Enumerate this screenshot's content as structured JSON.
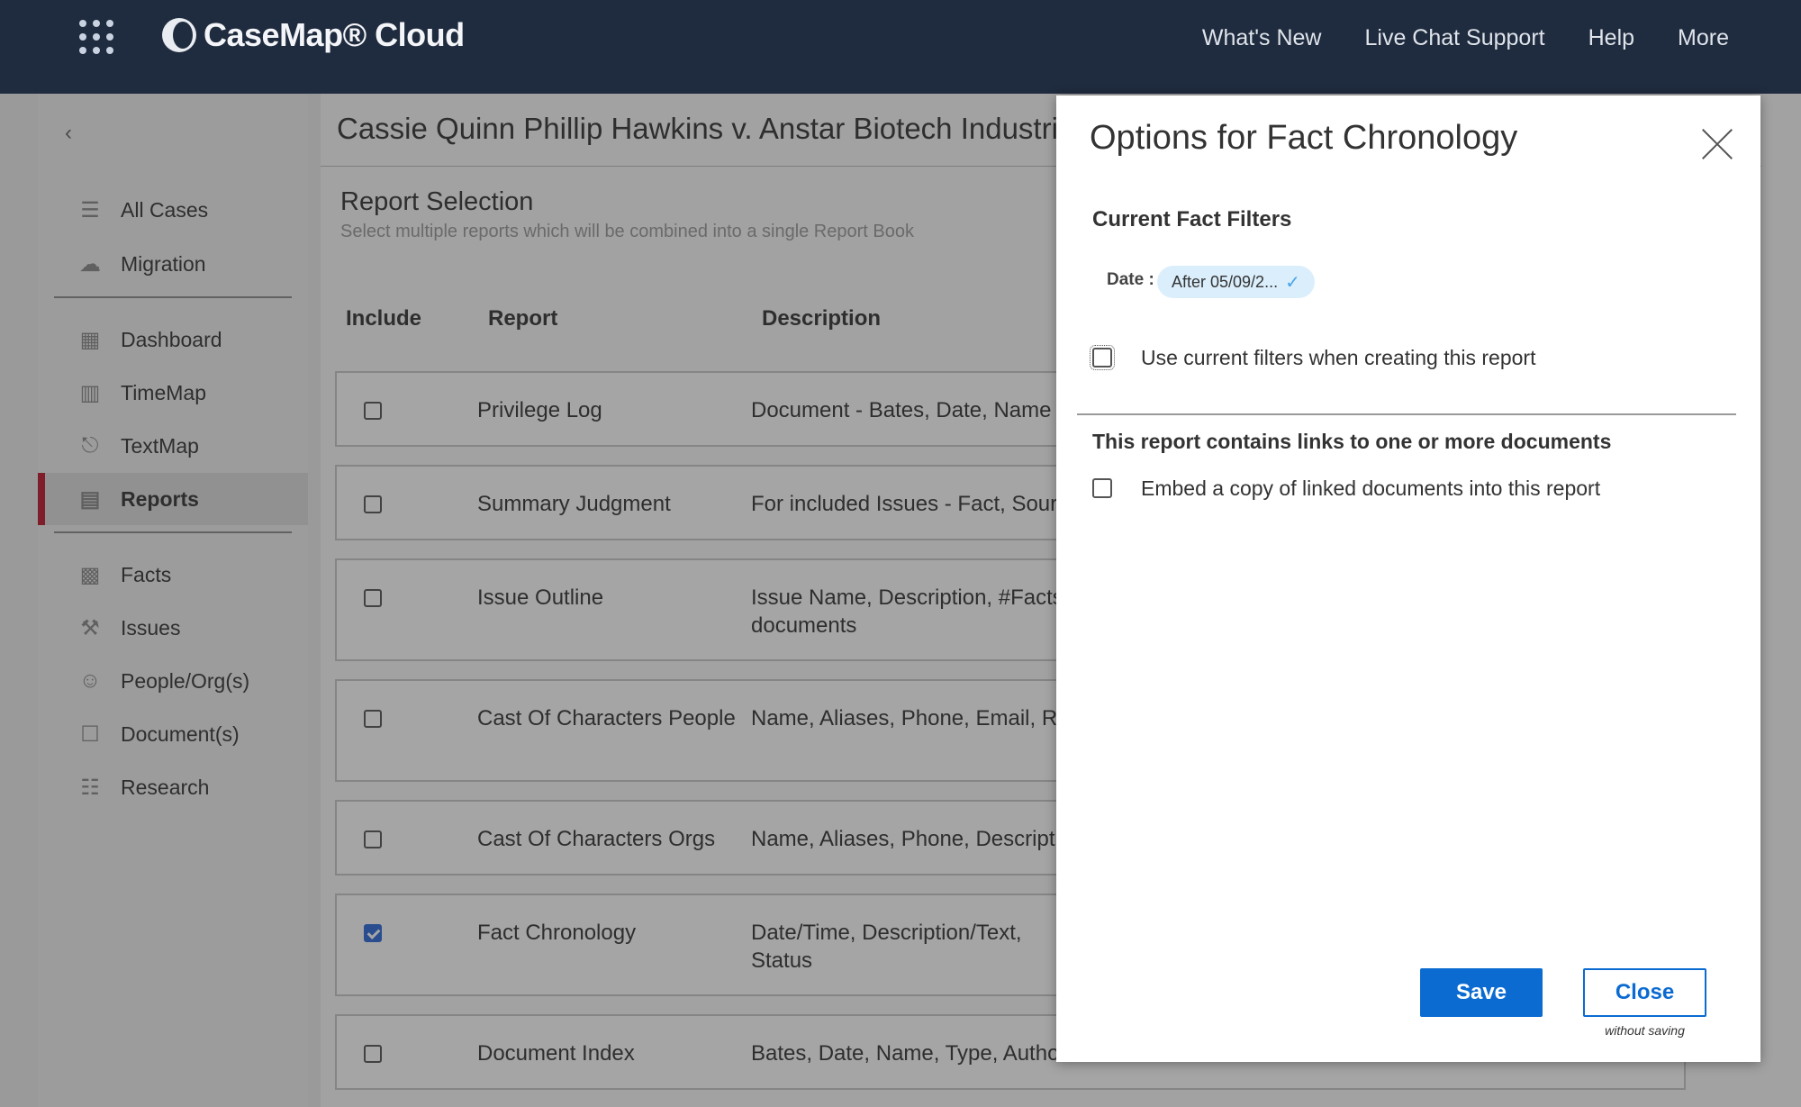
{
  "topbar": {
    "logo_text": "CaseMap® Cloud",
    "nav": [
      "What's New",
      "Live Chat Support",
      "Help",
      "More"
    ]
  },
  "sidebar": {
    "items": [
      {
        "label": "All Cases",
        "icon": "list-icon"
      },
      {
        "label": "Migration",
        "icon": "cloud-upload-icon"
      },
      {
        "label": "Dashboard",
        "icon": "dashboard-icon"
      },
      {
        "label": "TimeMap",
        "icon": "timemap-icon"
      },
      {
        "label": "TextMap",
        "icon": "microphone-icon"
      },
      {
        "label": "Reports",
        "icon": "reports-icon",
        "active": true
      },
      {
        "label": "Facts",
        "icon": "facts-icon"
      },
      {
        "label": "Issues",
        "icon": "gavel-icon"
      },
      {
        "label": "People/Org(s)",
        "icon": "people-icon"
      },
      {
        "label": "Document(s)",
        "icon": "document-icon"
      },
      {
        "label": "Research",
        "icon": "library-icon"
      }
    ]
  },
  "main": {
    "case_title": "Cassie Quinn Phillip Hawkins v. Anstar Biotech Industries",
    "section_title": "Report Selection",
    "section_subtitle": "Select multiple reports which will be combined into a single Report Book",
    "columns": [
      "Include",
      "Report",
      "Description"
    ],
    "rows": [
      {
        "name": "Privilege Log",
        "description": "Document - Bates, Date, Name",
        "checked": false
      },
      {
        "name": "Summary Judgment",
        "description": "For included Issues - Fact, Source",
        "checked": false
      },
      {
        "name": "Issue Outline",
        "description": "Issue Name, Description, #Facts\ndocuments",
        "checked": false
      },
      {
        "name": "Cast Of Characters People",
        "description": "Name, Aliases, Phone, Email, Role",
        "checked": false
      },
      {
        "name": "Cast Of Characters Orgs",
        "description": "Name, Aliases, Phone, Description",
        "checked": false
      },
      {
        "name": "Fact Chronology",
        "description": "Date/Time, Description/Text,\nStatus",
        "checked": true
      },
      {
        "name": "Document Index",
        "description": "Bates, Date, Name, Type, Author",
        "checked": false
      }
    ]
  },
  "modal": {
    "title": "Options for Fact Chronology",
    "current_filters_heading": "Current Fact Filters",
    "date_label": "Date :",
    "date_chip": "After 05/09/2...",
    "use_filters_label": "Use current filters when creating this report",
    "use_filters_checked": false,
    "links_heading": "This report contains links to one or more documents",
    "embed_label": "Embed a copy of linked documents into this report",
    "embed_checked": false,
    "save_label": "Save",
    "close_label": "Close",
    "close_note": "without saving"
  }
}
